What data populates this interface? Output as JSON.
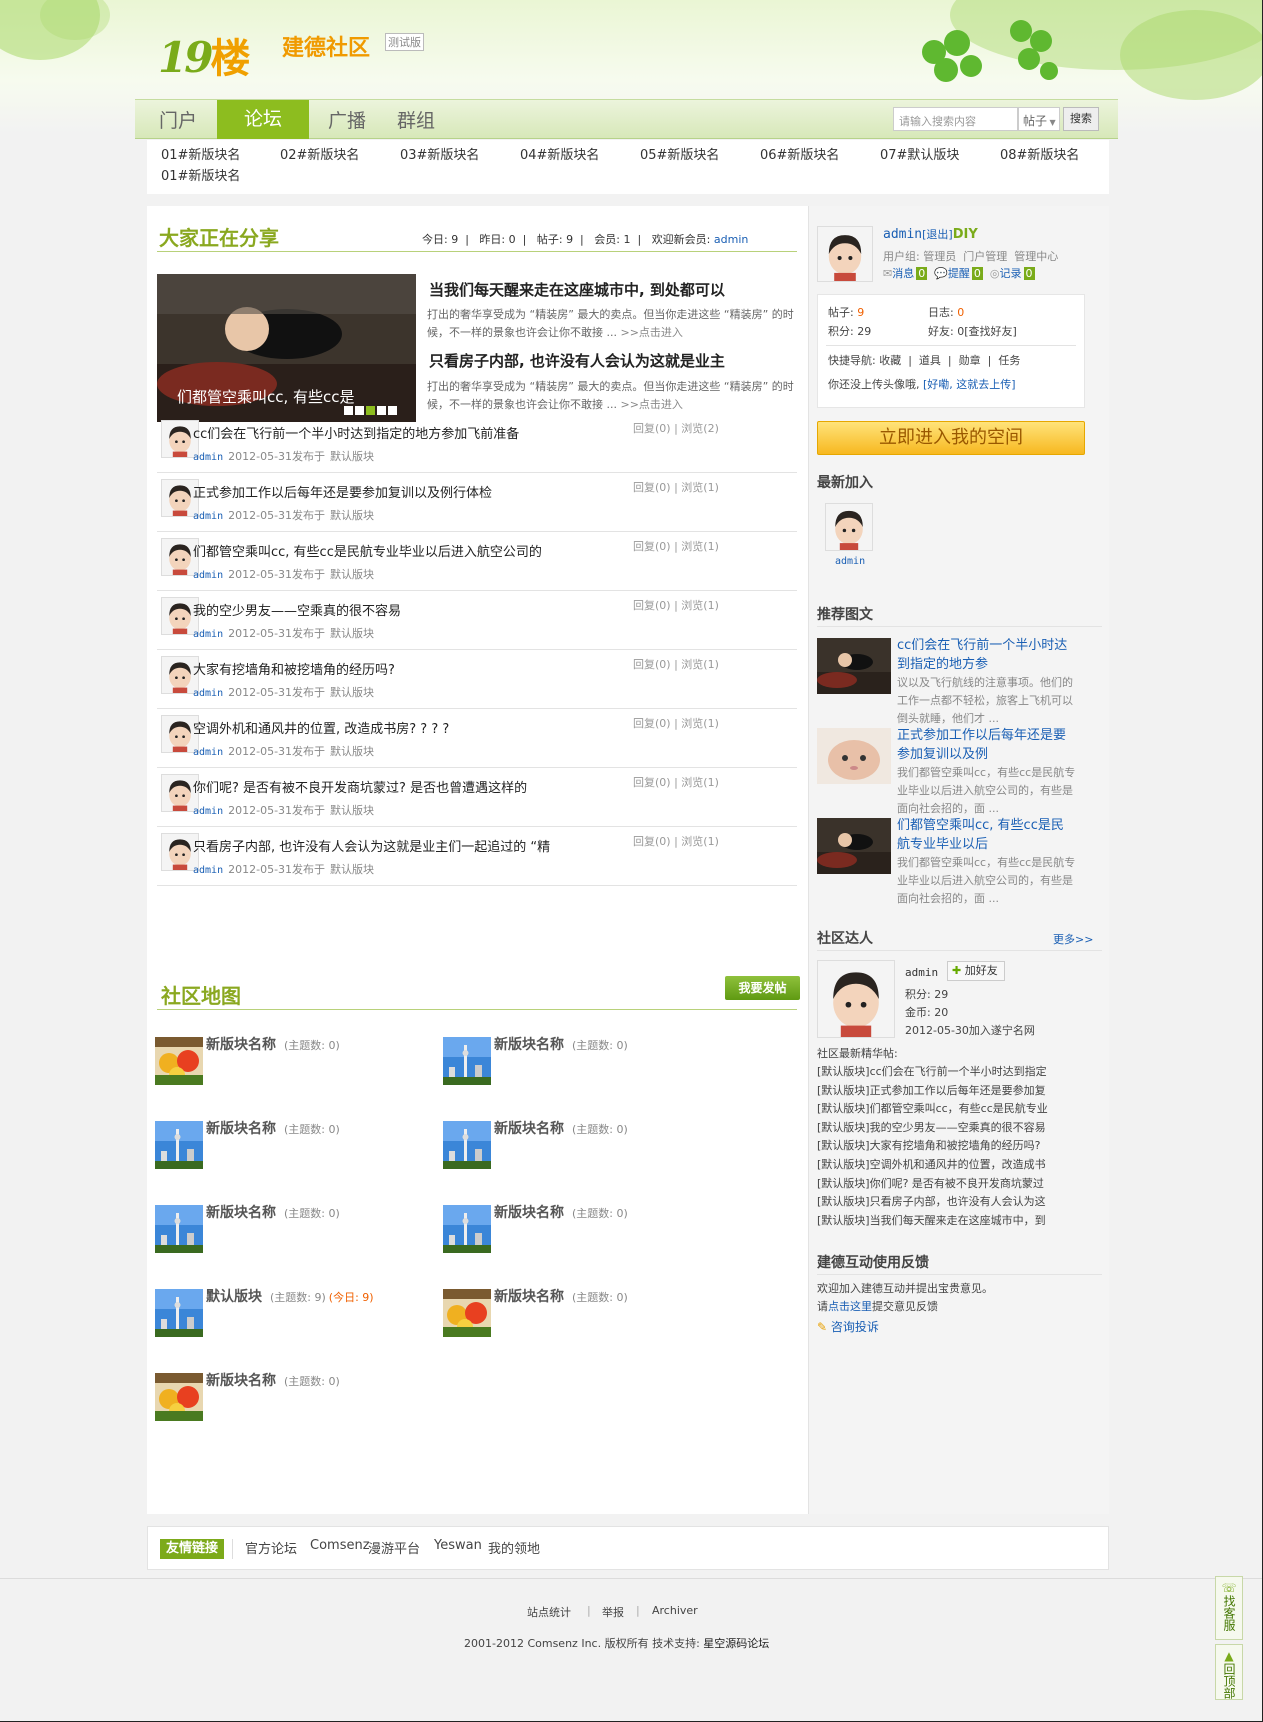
{
  "header": {
    "logo_num": "19",
    "logo_char": "楼",
    "site_name": "建德社区",
    "site_tag": "测试版"
  },
  "nav": {
    "items": [
      "门户",
      "论坛",
      "广播",
      "群组"
    ],
    "active": "论坛",
    "search_placeholder": "请输入搜索内容",
    "search_type": "帖子",
    "search_button": "搜索"
  },
  "subnav": {
    "items": [
      "01#新版块名",
      "02#新版块名",
      "03#新版块名",
      "04#新版块名",
      "05#新版块名",
      "06#新版块名",
      "07#默认版块",
      "08#新版块名",
      "01#新版块名"
    ]
  },
  "share": {
    "title": "大家正在分享",
    "stats": {
      "today_label": "今日:",
      "today": "9",
      "yesterday_label": "昨日:",
      "yesterday": "0",
      "posts_label": "帖子:",
      "posts": "9",
      "members_label": "会员:",
      "members": "1",
      "newmember_label": "欢迎新会员:",
      "newmember": "admin"
    },
    "slide_caption": "们都管空乘叫cc, 有些cc是",
    "slide_dots": 5,
    "slide_active": 2,
    "featured": [
      {
        "title": "当我们每天醒来走在这座城市中, 到处都可以",
        "desc": "打出的奢华享受成为 “精装房” 最大的卖点。但当你走进这些 “精装房” 的时候，不一样的景象也许会让你不敢接 ...",
        "more": ">>点击进入"
      },
      {
        "title": "只看房子内部, 也许没有人会认为这就是业主",
        "desc": "打出的奢华享受成为 “精装房” 最大的卖点。但当你走进这些 “精装房” 的时候，不一样的景象也许会让你不敢接 ...",
        "more": ">>点击进入"
      }
    ],
    "threads": [
      {
        "title": "cc们会在飞行前一个半小时达到指定的地方参加飞前准备",
        "author": "admin",
        "date": "2012-05-31发布于",
        "forum": "默认版块",
        "replies": "回复(0)",
        "views": "浏览(2)"
      },
      {
        "title": "正式参加工作以后每年还是要参加复训以及例行体检",
        "author": "admin",
        "date": "2012-05-31发布于",
        "forum": "默认版块",
        "replies": "回复(0)",
        "views": "浏览(1)"
      },
      {
        "title": "们都管空乘叫cc, 有些cc是民航专业毕业以后进入航空公司的",
        "author": "admin",
        "date": "2012-05-31发布于",
        "forum": "默认版块",
        "replies": "回复(0)",
        "views": "浏览(1)"
      },
      {
        "title": "我的空少男友——空乘真的很不容易",
        "author": "admin",
        "date": "2012-05-31发布于",
        "forum": "默认版块",
        "replies": "回复(0)",
        "views": "浏览(1)"
      },
      {
        "title": "大家有挖墙角和被挖墙角的经历吗?",
        "author": "admin",
        "date": "2012-05-31发布于",
        "forum": "默认版块",
        "replies": "回复(0)",
        "views": "浏览(1)"
      },
      {
        "title": "空调外机和通风井的位置, 改造成书房? ? ? ?",
        "author": "admin",
        "date": "2012-05-31发布于",
        "forum": "默认版块",
        "replies": "回复(0)",
        "views": "浏览(1)"
      },
      {
        "title": "你们呢? 是否有被不良开发商坑蒙过? 是否也曾遭遇这样的",
        "author": "admin",
        "date": "2012-05-31发布于",
        "forum": "默认版块",
        "replies": "回复(0)",
        "views": "浏览(1)"
      },
      {
        "title": "只看房子内部, 也许没有人会认为这就是业主们一起追过的 “精",
        "author": "admin",
        "date": "2012-05-31发布于",
        "forum": "默认版块",
        "replies": "回复(0)",
        "views": "浏览(1)"
      }
    ]
  },
  "map": {
    "title": "社区地图",
    "post_button": "我要发帖",
    "forums": [
      {
        "name": "新版块名称",
        "count": "(主题数: 0)",
        "today": "",
        "thumb": "flowers"
      },
      {
        "name": "新版块名称",
        "count": "(主题数: 0)",
        "today": "",
        "thumb": "city"
      },
      {
        "name": "新版块名称",
        "count": "(主题数: 0)",
        "today": "",
        "thumb": "city"
      },
      {
        "name": "新版块名称",
        "count": "(主题数: 0)",
        "today": "",
        "thumb": "city"
      },
      {
        "name": "新版块名称",
        "count": "(主题数: 0)",
        "today": "",
        "thumb": "city"
      },
      {
        "name": "新版块名称",
        "count": "(主题数: 0)",
        "today": "",
        "thumb": "city"
      },
      {
        "name": "默认版块",
        "count": "(主题数: 9)",
        "today": "(今日: 9)",
        "thumb": "city"
      },
      {
        "name": "新版块名称",
        "count": "(主题数: 0)",
        "today": "",
        "thumb": "flowers"
      },
      {
        "name": "新版块名称",
        "count": "(主题数: 0)",
        "today": "",
        "thumb": "flowers"
      }
    ]
  },
  "sidebar": {
    "user": {
      "name": "admin",
      "logout": "[退出]",
      "diy": "DIY",
      "group_label": "用户组:",
      "group": "管理员",
      "links": [
        "门户管理",
        "管理中心"
      ],
      "msg": "消息",
      "msg_n": "0",
      "remind": "提醒",
      "remind_n": "0",
      "record": "记录",
      "record_n": "0"
    },
    "stats": {
      "posts_label": "帖子:",
      "posts": "9",
      "logs_label": "日志:",
      "logs": "0",
      "points_label": "积分:",
      "points": "29",
      "friends_label": "好友:",
      "friends": "0[查找好友]",
      "quick_label": "快捷导航:",
      "quick": [
        "收藏",
        "道具",
        "勋章",
        "任务"
      ],
      "avatar_note": "你还没上传头像哦,",
      "avatar_link": "[好嘞, 这就去上传]"
    },
    "space_button": "立即进入我的空间",
    "newest": {
      "title": "最新加入",
      "name": "admin"
    },
    "recommend": {
      "title": "推荐图文",
      "items": [
        {
          "title": "cc们会在飞行前一个半小时达到指定的地方参",
          "desc": "议以及飞行航线的注意事项。他们的工作一点都不轻松，旅客上飞机可以倒头就睡，他们才 ...",
          "thumb": "child"
        },
        {
          "title": "正式参加工作以后每年还是要参加复训以及例",
          "desc": "我们都管空乘叫cc，有些cc是民航专业毕业以后进入航空公司的，有些是面向社会招的，面 ...",
          "thumb": "cat"
        },
        {
          "title": "们都管空乘叫cc, 有些cc是民航专业毕业以后",
          "desc": "我们都管空乘叫cc，有些cc是民航专业毕业以后进入航空公司的，有些是面向社会招的，面 ...",
          "thumb": "child"
        }
      ]
    },
    "experts": {
      "title": "社区达人",
      "more": "更多>>",
      "name": "admin",
      "add_friend": "加好友",
      "points": "积分: 29",
      "coins": "金币: 20",
      "joined": "2012-05-30加入遂宁名网",
      "essence_title": "社区最新精华帖:",
      "essence": [
        "[默认版块]cc们会在飞行前一个半小时达到指定",
        "[默认版块]正式参加工作以后每年还是要参加复",
        "[默认版块]们都管空乘叫cc，有些cc是民航专业",
        "[默认版块]我的空少男友——空乘真的很不容易",
        "[默认版块]大家有挖墙角和被挖墙角的经历吗?",
        "[默认版块]空调外机和通风井的位置，改造成书",
        "[默认版块]你们呢? 是否有被不良开发商坑蒙过",
        "[默认版块]只看房子内部，也许没有人会认为这",
        "[默认版块]当我们每天醒来走在这座城市中，到"
      ]
    },
    "feedback": {
      "title": "建德互动使用反馈",
      "line1": "欢迎加入建德互动并提出宝贵意见。",
      "line2_pre": "请",
      "line2_link": "点击这里",
      "line2_post": "提交意见反馈",
      "complain": "咨询投诉"
    }
  },
  "footer": {
    "links_label": "友情链接",
    "links": [
      "官方论坛",
      "Comsenz",
      "漫游平台",
      "Yeswan",
      "我的领地"
    ],
    "bottom": [
      "站点统计",
      "举报",
      "Archiver"
    ],
    "copyright": "2001-2012 Comsenz Inc. 版权所有 技术支持:",
    "support": "星空源码论坛"
  },
  "float": {
    "service": "找客服",
    "top": "回顶部"
  },
  "colors": {
    "accent_green": "#8dbd1f",
    "link_blue": "#1a5fb4",
    "orange": "#f06000"
  }
}
